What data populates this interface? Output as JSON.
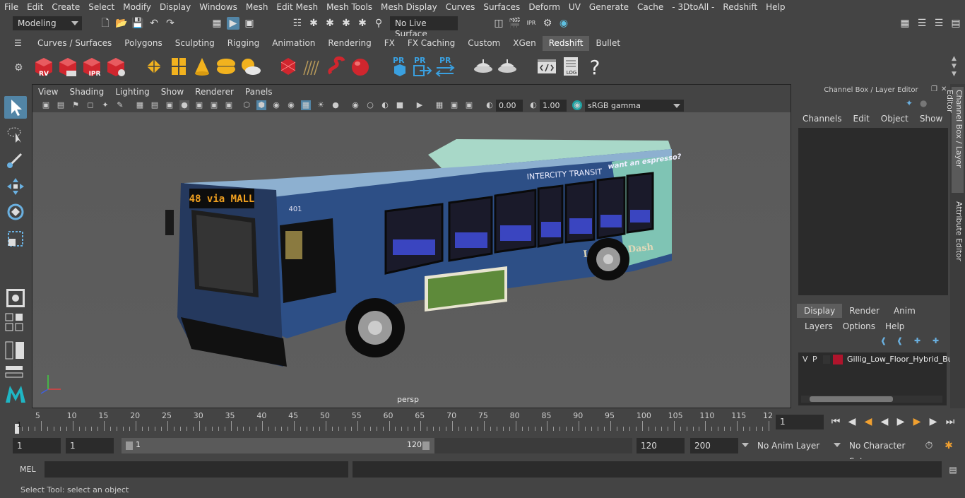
{
  "menubar": [
    "File",
    "Edit",
    "Create",
    "Select",
    "Modify",
    "Display",
    "Windows",
    "Mesh",
    "Edit Mesh",
    "Mesh Tools",
    "Mesh Display",
    "Curves",
    "Surfaces",
    "Deform",
    "UV",
    "Generate",
    "Cache",
    "- 3DtoAll -",
    "Redshift",
    "Help"
  ],
  "status": {
    "mode": "Modeling",
    "live_surface": "No Live Surface"
  },
  "shelf_tabs": [
    "Curves / Surfaces",
    "Polygons",
    "Sculpting",
    "Rigging",
    "Animation",
    "Rendering",
    "FX",
    "FX Caching",
    "Custom",
    "XGen",
    "Redshift",
    "Bullet"
  ],
  "shelf_active": "Redshift",
  "shelf_icon_labels": {
    "rv": "RV",
    "ipr": "IPR",
    "pr": "PR",
    "log": "LOG",
    "help": "?"
  },
  "panel_menu": [
    "View",
    "Shading",
    "Lighting",
    "Show",
    "Renderer",
    "Panels"
  ],
  "panel_toolbar": {
    "exposure": "0.00",
    "gamma": "1.00",
    "colorspace": "sRGB gamma"
  },
  "viewport": {
    "camera": "persp",
    "bus_sign": "48 via MALL",
    "bus_number": "401",
    "bus_brand": "INTERCITY TRANSIT",
    "bus_slogan": "want an espresso?",
    "bus_ad": "Let's Go Dash"
  },
  "right_panel": {
    "title": "Channel Box / Layer Editor",
    "menus": [
      "Channels",
      "Edit",
      "Object",
      "Show"
    ],
    "layer_tabs": [
      "Display",
      "Render",
      "Anim"
    ],
    "layer_menus": [
      "Layers",
      "Options",
      "Help"
    ],
    "layer": {
      "v": "V",
      "p": "P",
      "name": "Gillig_Low_Floor_Hybrid_Bus",
      "color": "#b0142c"
    }
  },
  "vertical_tabs": [
    "Channel Box / Layer Editor",
    "Attribute Editor"
  ],
  "timeline": {
    "ticks": [
      "5",
      "10",
      "15",
      "20",
      "25",
      "30",
      "35",
      "40",
      "45",
      "50",
      "55",
      "60",
      "65",
      "70",
      "75",
      "80",
      "85",
      "90",
      "95",
      "100",
      "105",
      "110",
      "115",
      "12"
    ],
    "start_marker": "1",
    "current_frame": "1"
  },
  "range": {
    "start": "1",
    "start2": "1",
    "slider_start": "1",
    "slider_end": "120",
    "end": "120",
    "end2": "200",
    "anim_layer": "No Anim Layer",
    "char_set": "No Character Set"
  },
  "cmdline": {
    "label": "MEL"
  },
  "help_text": "Select Tool: select an object",
  "colors": {
    "bg": "#444444",
    "field": "#2b2b2b",
    "active_tab": "#5d5d5d",
    "accent_blue": "#5285a6",
    "redshift_red": "#d0262e"
  }
}
